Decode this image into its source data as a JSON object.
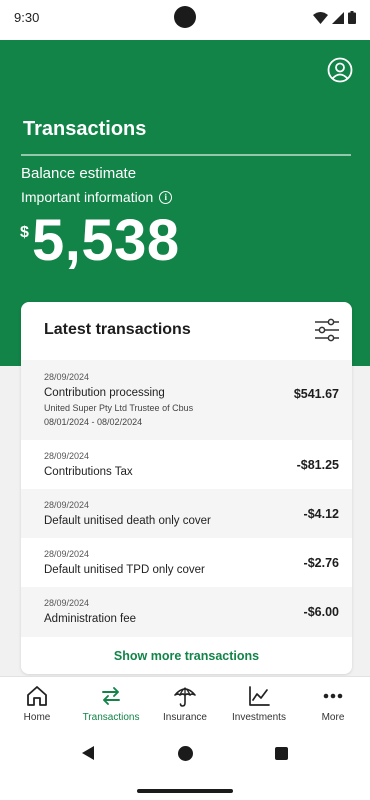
{
  "status": {
    "time": "9:30"
  },
  "header": {
    "title": "Transactions",
    "balance_label": "Balance estimate",
    "info_label": "Important information",
    "info_icon": "i",
    "currency": "$",
    "balance": "5,538"
  },
  "card": {
    "title": "Latest transactions",
    "show_more": "Show more transactions",
    "transactions": [
      {
        "date": "28/09/2024",
        "title": "Contribution processing",
        "line2": "United Super Pty Ltd Trustee of Cbus",
        "line3": "08/01/2024 - 08/02/2024",
        "amount": "$541.67"
      },
      {
        "date": "28/09/2024",
        "title": "Contributions Tax",
        "amount": "-$81.25"
      },
      {
        "date": "28/09/2024",
        "title": "Default unitised death only cover",
        "amount": "-$4.12"
      },
      {
        "date": "28/09/2024",
        "title": "Default unitised TPD only cover",
        "amount": "-$2.76"
      },
      {
        "date": "28/09/2024",
        "title": "Administration fee",
        "amount": "-$6.00"
      }
    ]
  },
  "nav": {
    "items": [
      {
        "label": "Home",
        "icon": "home-icon"
      },
      {
        "label": "Transactions",
        "icon": "transfer-arrows-icon"
      },
      {
        "label": "Insurance",
        "icon": "umbrella-icon"
      },
      {
        "label": "Investments",
        "icon": "line-chart-icon"
      },
      {
        "label": "More",
        "icon": "more-dots-icon"
      }
    ]
  },
  "colors": {
    "brand": "#128448",
    "background": "#f1f1f1"
  }
}
